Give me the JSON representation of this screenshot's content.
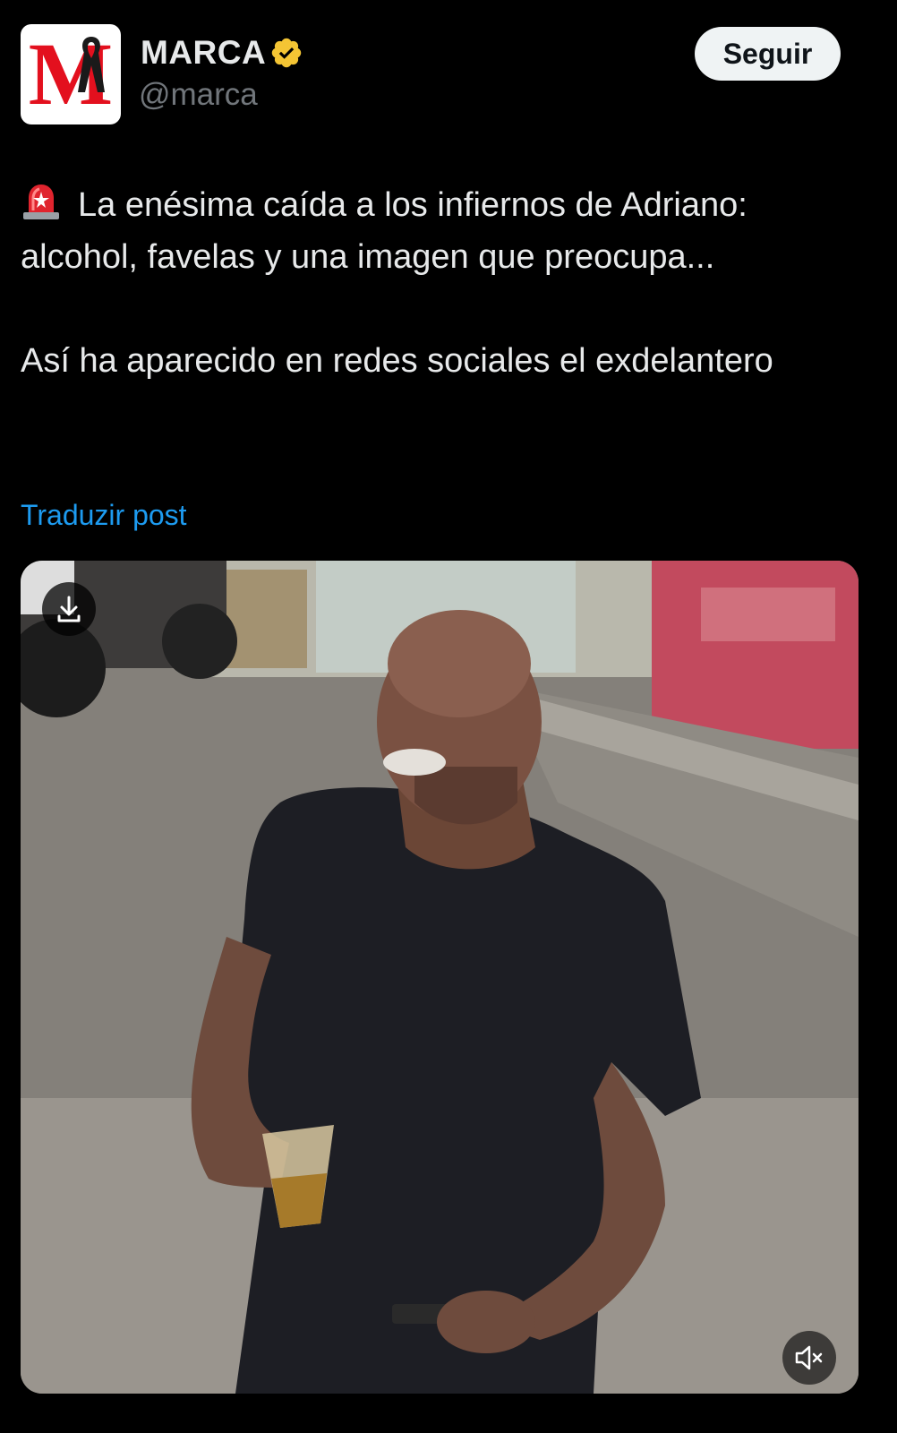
{
  "account": {
    "display_name": "MARCA",
    "handle": "@marca",
    "avatar_letter": "M",
    "verified_icon": "verified-badge-icon",
    "verified_color": "#f4c534"
  },
  "follow_button": {
    "label": "Seguir"
  },
  "post": {
    "paragraphs": [
      "La enésima caída a los infiernos de Adriano: alcohol, favelas y una imagen que preocupa...",
      "Así ha aparecido en redes sociales el exdelantero"
    ],
    "leading_emoji": "siren-icon"
  },
  "translate_link": {
    "label": "Traduzir post"
  },
  "media": {
    "type": "video",
    "controls": {
      "download": "download-icon",
      "mute": "muted-speaker-icon"
    }
  },
  "colors": {
    "background": "#000000",
    "text": "#e7e9ea",
    "secondary_text": "#71767b",
    "link": "#1d9bf0",
    "brand_red": "#e3101e"
  }
}
